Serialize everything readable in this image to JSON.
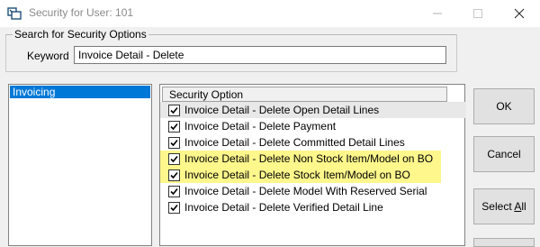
{
  "window": {
    "title": "Security for User: 101"
  },
  "search": {
    "group_label": "Search for Security Options",
    "keyword_label": "Keyword",
    "keyword_value": "Invoice Detail - Delete"
  },
  "modules": [
    {
      "label": "Invoicing"
    }
  ],
  "options": {
    "header": "Security Option",
    "items": [
      {
        "label": "Invoice Detail - Delete Open Detail Lines",
        "checked": true
      },
      {
        "label": "Invoice Detail - Delete Payment",
        "checked": true
      },
      {
        "label": "Invoice Detail - Delete Committed Detail Lines",
        "checked": true
      },
      {
        "label": "Invoice Detail - Delete Non Stock Item/Model on BO",
        "checked": true,
        "highlighted": true
      },
      {
        "label": "Invoice Detail - Delete Stock Item/Model on BO",
        "checked": true,
        "highlighted": true
      },
      {
        "label": "Invoice Detail - Delete Model With Reserved Serial",
        "checked": true
      },
      {
        "label": "Invoice Detail - Delete Verified Detail Line",
        "checked": true
      }
    ]
  },
  "buttons": {
    "ok": "OK",
    "cancel": "Cancel",
    "select_all_prefix": "Select ",
    "select_all_access": "A",
    "select_all_suffix": "ll"
  },
  "colors": {
    "highlight": "#fef78c",
    "selection": "#0078d7"
  }
}
